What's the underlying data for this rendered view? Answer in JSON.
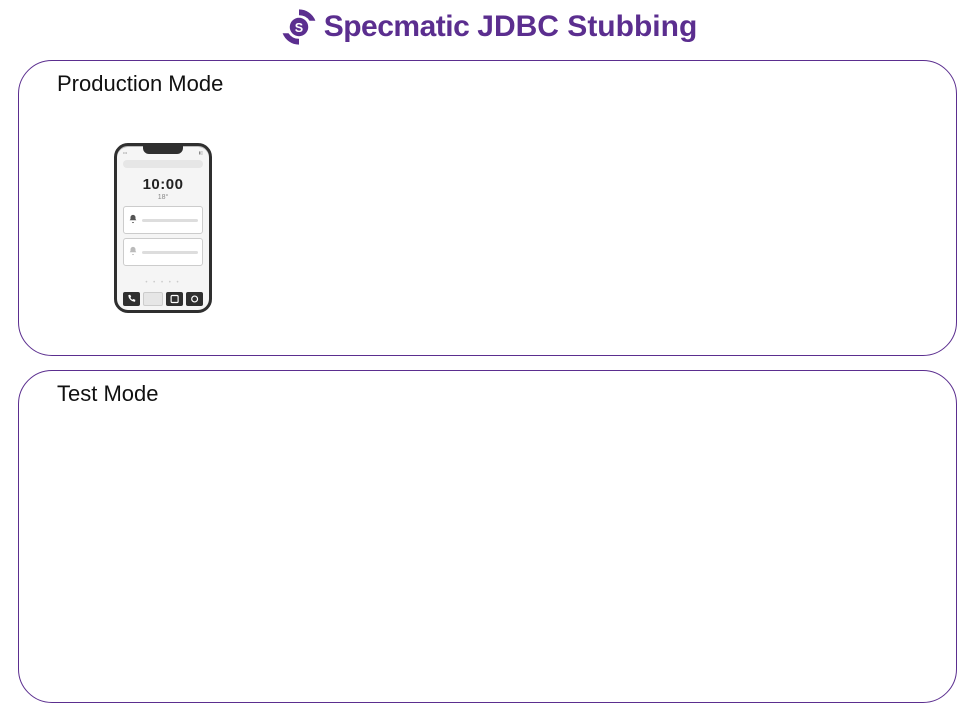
{
  "header": {
    "brand": "Specmatic",
    "title": "JDBC Stubbing"
  },
  "panels": {
    "production": {
      "label": "Production Mode"
    },
    "test": {
      "label": "Test Mode"
    }
  },
  "phone": {
    "time": "10:00",
    "sub": "18°",
    "dots": "• • • • •"
  },
  "colors": {
    "brand": "#5b2e8f"
  }
}
